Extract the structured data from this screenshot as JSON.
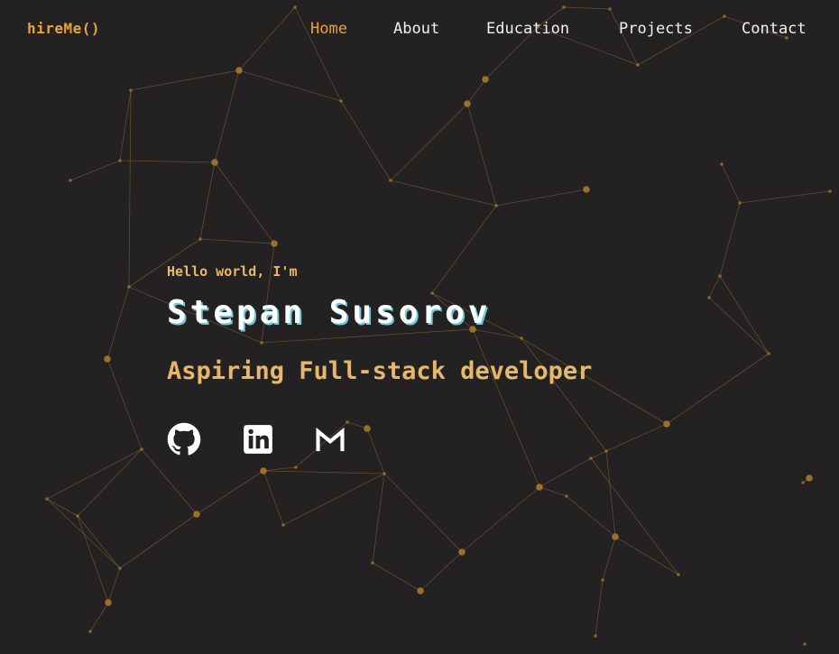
{
  "brand": {
    "logo_text": "hireMe()"
  },
  "nav": {
    "items": [
      {
        "label": "Home",
        "active": true
      },
      {
        "label": "About",
        "active": false
      },
      {
        "label": "Education",
        "active": false
      },
      {
        "label": "Projects",
        "active": false
      },
      {
        "label": "Contact",
        "active": false
      }
    ]
  },
  "hero": {
    "greeting": "Hello world, I'm",
    "name": "Stepan Susorov",
    "role": "Aspiring Full-stack developer"
  },
  "socials": [
    {
      "icon": "github-icon"
    },
    {
      "icon": "linkedin-icon"
    },
    {
      "icon": "gmail-icon"
    }
  ],
  "theme": {
    "background": "#232122",
    "accent": "#e8a33c",
    "accent_soft": "#e8b86a",
    "text": "#f2f2f2",
    "name_shadow": "#6fc7d6",
    "network_line": "#8a6a30",
    "network_node": "#b07a2c"
  }
}
